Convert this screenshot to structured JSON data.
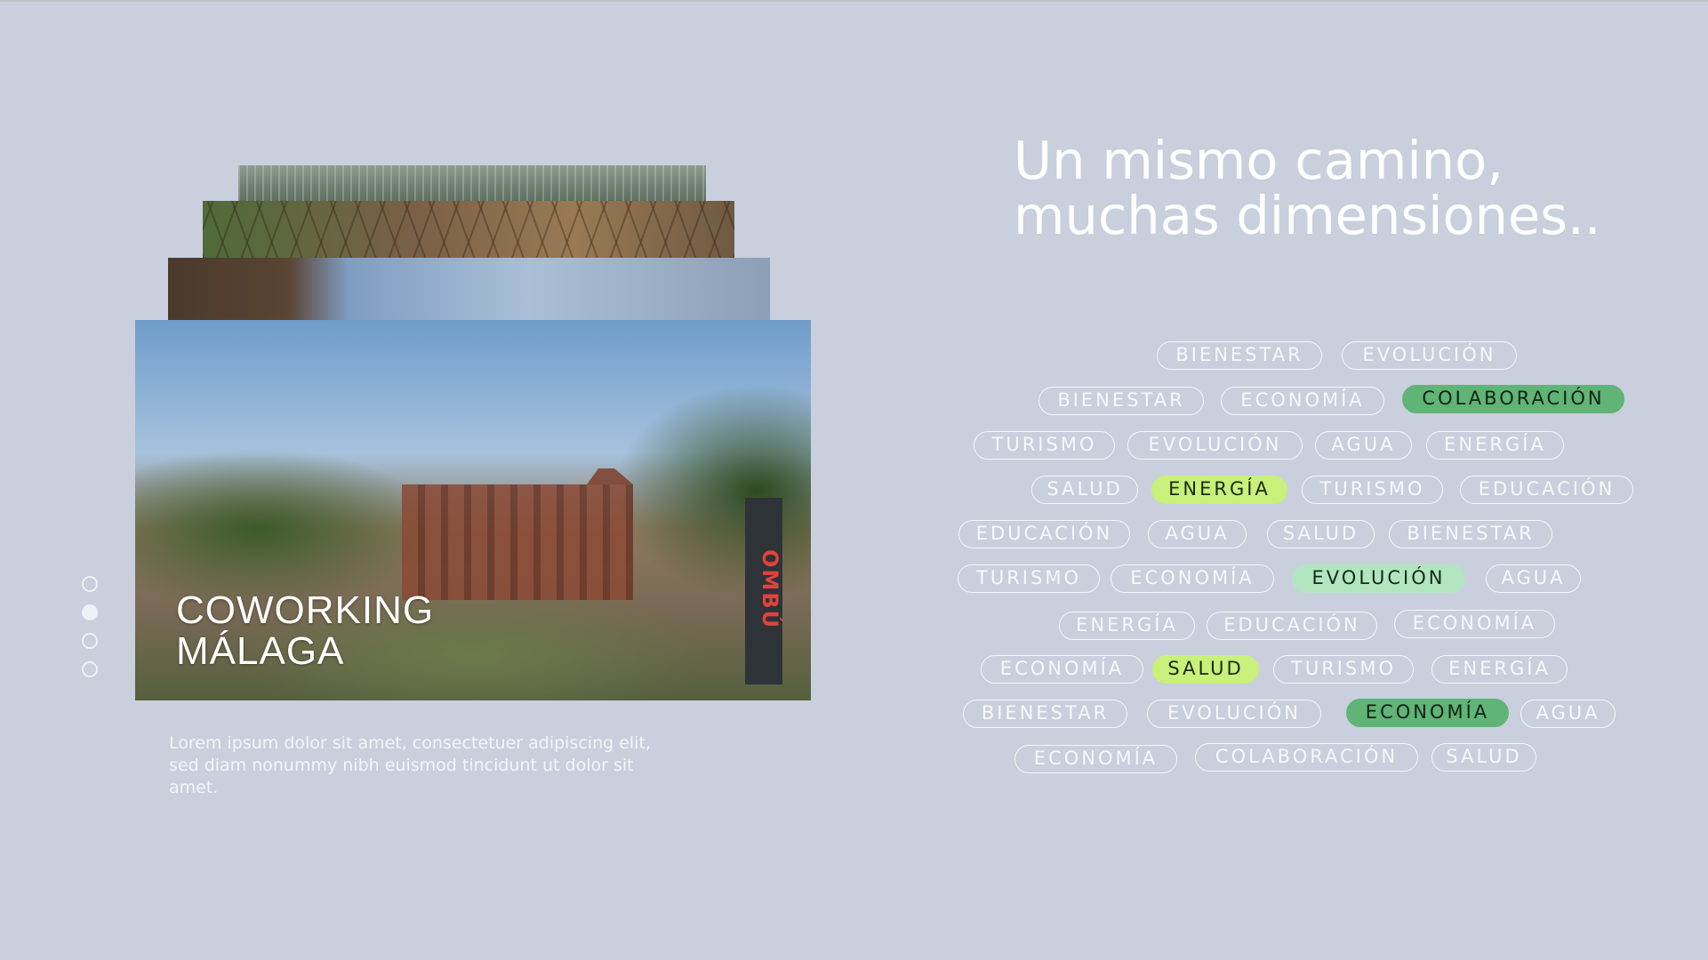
{
  "card": {
    "title_line1": "COWORKING",
    "title_line2": "MÁLAGA",
    "sign_text": "OMBÚ"
  },
  "description": "Lorem ipsum dolor sit amet, consectetuer adipiscing elit, sed diam nonummy nibh euismod tincidunt ut dolor sit amet.",
  "heading": {
    "line1": "Un mismo camino,",
    "line2": "muchas dimensiones.."
  },
  "pagination": {
    "total": 4,
    "active": 2
  },
  "colors": {
    "background": "#c9cfdc",
    "tag_highlight_dark": "#5fb476",
    "tag_highlight_lime": "#c8f07a",
    "tag_highlight_light": "#b2e6c1"
  },
  "tags": [
    {
      "label": "BIENESTAR",
      "highlight": ""
    },
    {
      "label": "EVOLUCIÓN",
      "highlight": ""
    },
    {
      "label": "BIENESTAR",
      "highlight": ""
    },
    {
      "label": "ECONOMÍA",
      "highlight": ""
    },
    {
      "label": "COLABORACIÓN",
      "highlight": "dark"
    },
    {
      "label": "TURISMO",
      "highlight": ""
    },
    {
      "label": "EVOLUCIÓN",
      "highlight": ""
    },
    {
      "label": "AGUA",
      "highlight": ""
    },
    {
      "label": "ENERGÍA",
      "highlight": ""
    },
    {
      "label": "SALUD",
      "highlight": ""
    },
    {
      "label": "ENERGÍA",
      "highlight": "lime"
    },
    {
      "label": "TURISMO",
      "highlight": ""
    },
    {
      "label": "EDUCACIÓN",
      "highlight": ""
    },
    {
      "label": "EDUCACIÓN",
      "highlight": ""
    },
    {
      "label": "AGUA",
      "highlight": ""
    },
    {
      "label": "SALUD",
      "highlight": ""
    },
    {
      "label": "BIENESTAR",
      "highlight": ""
    },
    {
      "label": "TURISMO",
      "highlight": ""
    },
    {
      "label": "ECONOMÍA",
      "highlight": ""
    },
    {
      "label": "EVOLUCIÓN",
      "highlight": "light"
    },
    {
      "label": "AGUA",
      "highlight": ""
    },
    {
      "label": "ENERGÍA",
      "highlight": ""
    },
    {
      "label": "EDUCACIÓN",
      "highlight": ""
    },
    {
      "label": "ECONOMÍA",
      "highlight": ""
    },
    {
      "label": "ECONOMÍA",
      "highlight": ""
    },
    {
      "label": "SALUD",
      "highlight": "lime"
    },
    {
      "label": "TURISMO",
      "highlight": ""
    },
    {
      "label": "ENERGÍA",
      "highlight": ""
    },
    {
      "label": "BIENESTAR",
      "highlight": ""
    },
    {
      "label": "EVOLUCIÓN",
      "highlight": ""
    },
    {
      "label": "ECONOMÍA",
      "highlight": "dark"
    },
    {
      "label": "AGUA",
      "highlight": ""
    },
    {
      "label": "ECONOMÍA",
      "highlight": ""
    },
    {
      "label": "COLABORACIÓN",
      "highlight": ""
    },
    {
      "label": "SALUD",
      "highlight": ""
    }
  ]
}
